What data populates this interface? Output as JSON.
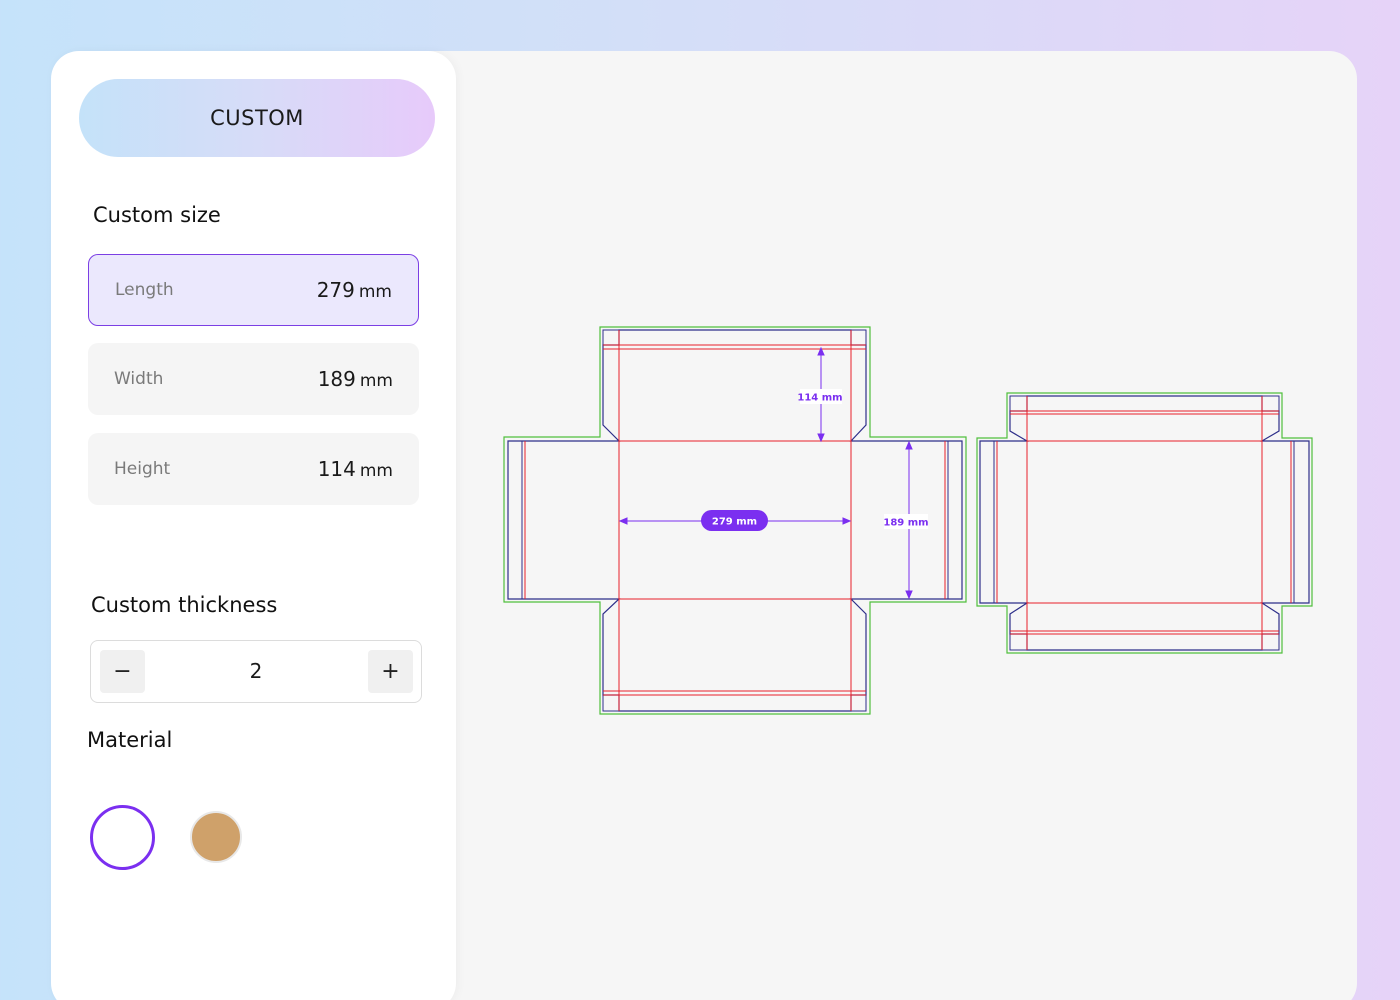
{
  "header": {
    "mode_label": "CUSTOM"
  },
  "custom_size": {
    "title": "Custom size",
    "length": {
      "label": "Length",
      "value": "279",
      "unit": "mm"
    },
    "width": {
      "label": "Width",
      "value": "189",
      "unit": "mm"
    },
    "height": {
      "label": "Height",
      "value": "114",
      "unit": "mm"
    }
  },
  "thickness": {
    "title": "Custom thickness",
    "value": "2",
    "minus": "−",
    "plus": "+"
  },
  "material": {
    "title": "Material",
    "options": [
      {
        "name": "white",
        "color": "#ffffff",
        "selected": true
      },
      {
        "name": "kraft",
        "color": "#cfa16a",
        "selected": false
      }
    ]
  },
  "dieline": {
    "length_label": "279 mm",
    "width_label": "189 mm",
    "height_label": "114 mm",
    "colors": {
      "cut": "#2e2f8a",
      "fold": "#e8202a",
      "bleed": "#4fbf3c",
      "dimension": "#7b2ff0"
    }
  }
}
